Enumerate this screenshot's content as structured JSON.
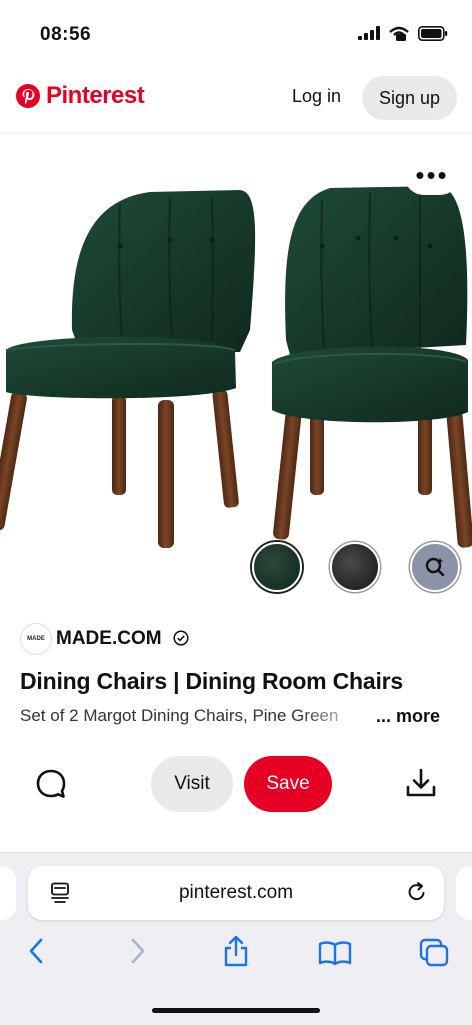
{
  "status_bar": {
    "time": "08:56"
  },
  "header": {
    "brand": "Pinterest",
    "login_label": "Log in",
    "signup_label": "Sign up"
  },
  "pin": {
    "more_label": "•••",
    "source": {
      "avatar_text": "MADE",
      "name": "MADE.COM"
    },
    "title": "Dining Chairs | Dining Room Chairs",
    "description": "Set of 2 Margot Dining Chairs, Pine Green",
    "more_label_text": "... more",
    "visit_label": "Visit",
    "save_label": "Save",
    "swatches": [
      "dark green",
      "black",
      "visual search"
    ]
  },
  "browser": {
    "url": "pinterest.com",
    "icons": [
      "page-menu-icon",
      "reload-icon",
      "back-icon",
      "forward-icon",
      "share-icon",
      "bookmarks-icon",
      "tabs-icon"
    ]
  },
  "colors": {
    "brand_red": "#e60023",
    "chair_green": "#173c2b",
    "wood": "#6b3a20"
  }
}
